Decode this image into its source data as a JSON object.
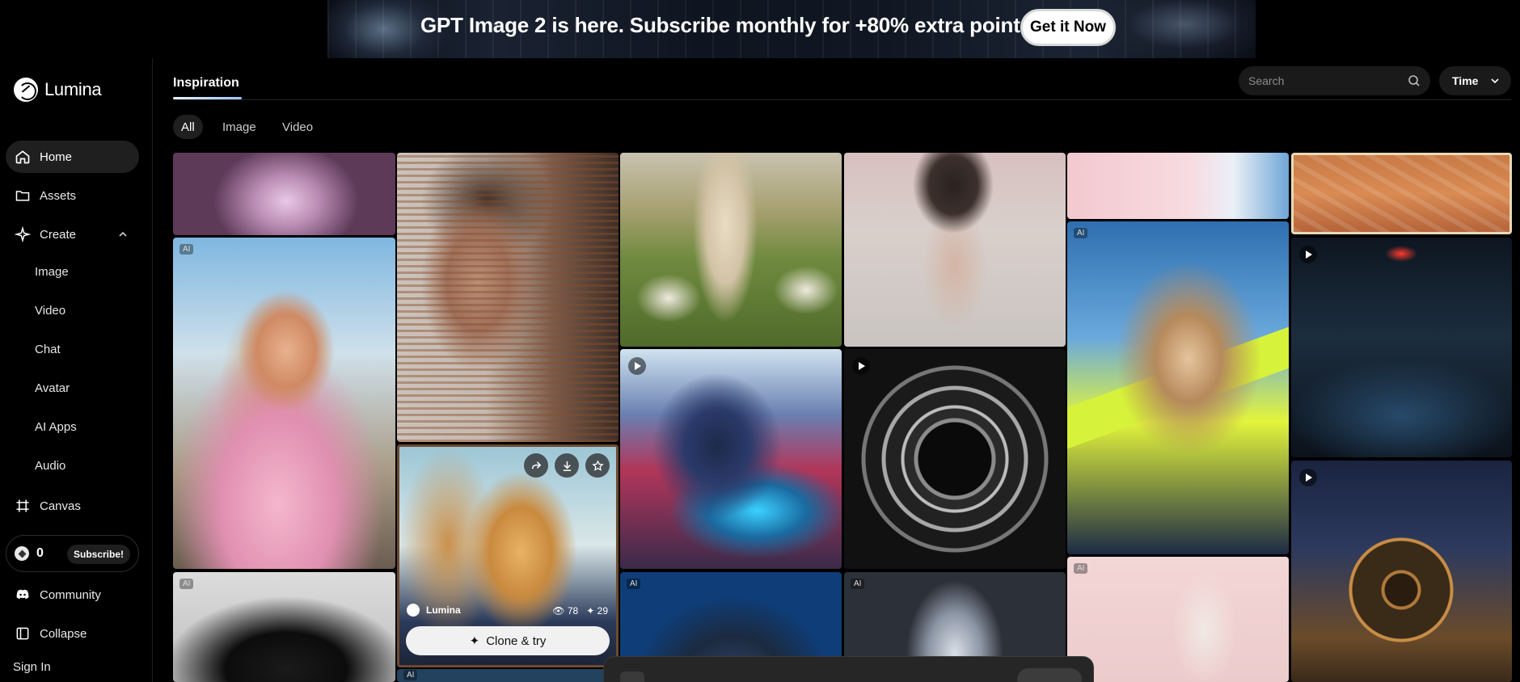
{
  "banner": {
    "text": "GPT Image 2 is here. Subscribe monthly for +80% extra points!",
    "cta": "Get it Now"
  },
  "brand": {
    "name": "Lumina"
  },
  "sidebar": {
    "items": [
      {
        "label": "Home",
        "icon": "home-icon"
      },
      {
        "label": "Assets",
        "icon": "folder-icon"
      },
      {
        "label": "Create",
        "icon": "sparkle-icon"
      }
    ],
    "create_sub": [
      "Image",
      "Video",
      "Chat",
      "Avatar",
      "AI Apps",
      "Audio"
    ],
    "canvas": "Canvas",
    "points": "0",
    "subscribe": "Subscribe!",
    "community": "Community",
    "collapse": "Collapse",
    "sign_in": "Sign In"
  },
  "header": {
    "tab": "Inspiration",
    "search_placeholder": "Search",
    "sort": "Time",
    "filters": [
      "All",
      "Image",
      "Video"
    ]
  },
  "card": {
    "author": "Lumina",
    "views": "78",
    "likes": "29",
    "clone": "Clone & try"
  },
  "badges": {
    "ai": "AI"
  },
  "colors": {
    "accent_underline": "#9bc4ff",
    "background": "#000000"
  }
}
